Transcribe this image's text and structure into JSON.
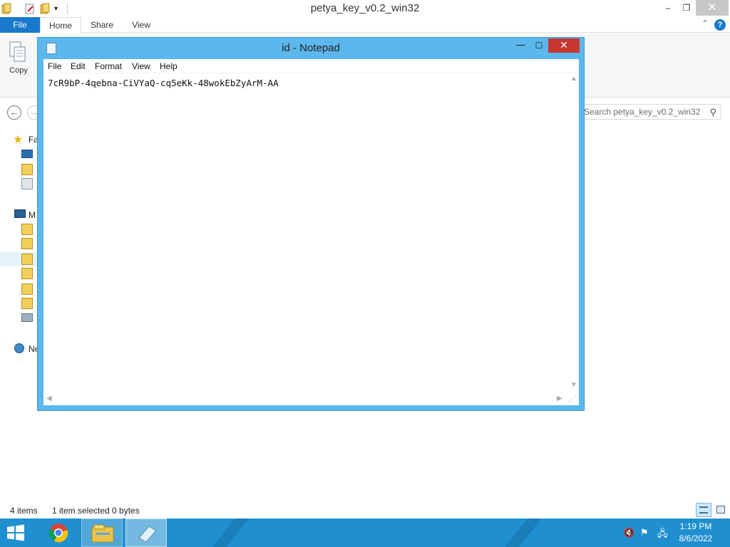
{
  "explorer": {
    "title": "petya_key_v0.2_win32",
    "window_controls": {
      "minimize": "–",
      "maximize": "❐",
      "close": "✕"
    },
    "tabs": [
      {
        "label": "File"
      },
      {
        "label": "Home"
      },
      {
        "label": "Share"
      },
      {
        "label": "View"
      }
    ],
    "help": "?",
    "ribbon": {
      "copy_label": "Copy"
    },
    "search": {
      "placeholder": "Search petya_key_v0.2_win32"
    },
    "nav_pane": {
      "favorites_label": "Fa",
      "computer_label": "M",
      "network_label": "Ne"
    },
    "status": {
      "item_count": "4 items",
      "selection": "1 item selected  0 bytes"
    }
  },
  "notepad": {
    "title": "id - Notepad",
    "window_controls": {
      "minimize": "—",
      "maximize": "☐",
      "close": "✕"
    },
    "menu": [
      {
        "label": "File"
      },
      {
        "label": "Edit"
      },
      {
        "label": "Format"
      },
      {
        "label": "View"
      },
      {
        "label": "Help"
      }
    ],
    "content": "7cR9bP-4qebna-CiVYaQ-cq5eKk-48wokEbZyArM-AA"
  },
  "taskbar": {
    "apps": [
      {
        "name": "Google Chrome"
      },
      {
        "name": "File Explorer"
      },
      {
        "name": "Notepad"
      }
    ],
    "clock": {
      "time": "1:19 PM",
      "date": "8/6/2022"
    },
    "colors": {
      "taskbar": "#1f8fd0",
      "accent": "#1979ca",
      "close": "#c7372f"
    }
  }
}
